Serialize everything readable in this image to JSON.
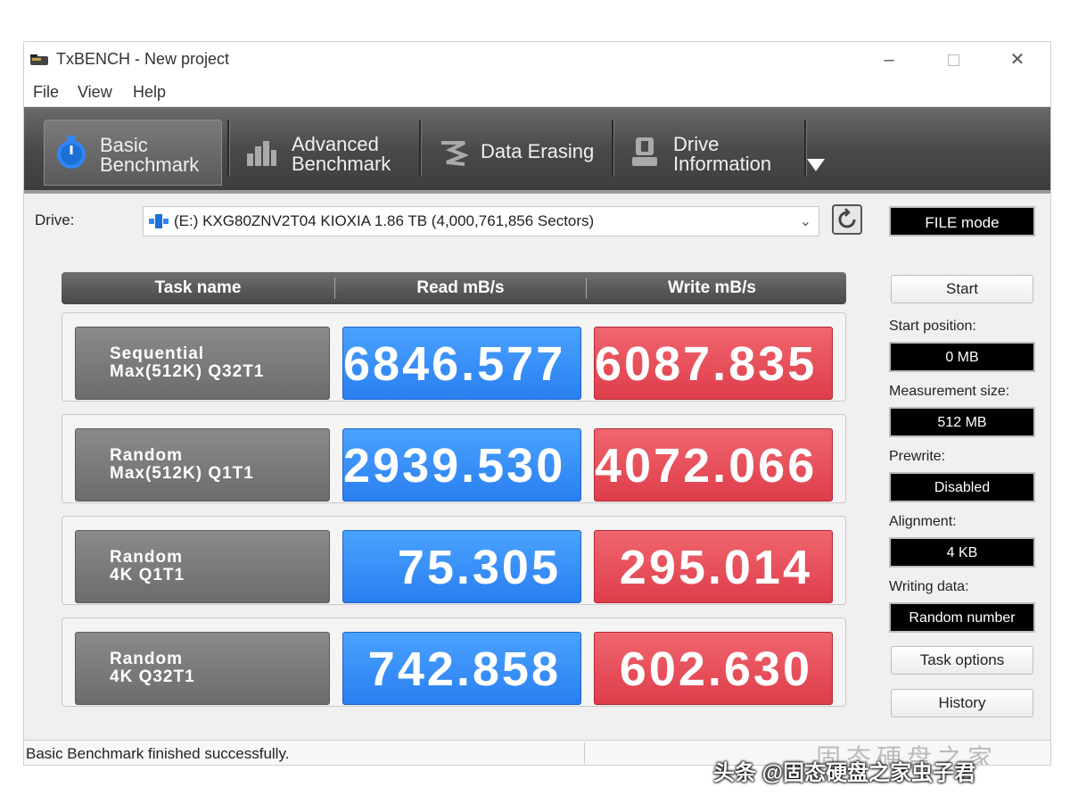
{
  "window": {
    "title": "TxBENCH - New project"
  },
  "menu": [
    "File",
    "View",
    "Help"
  ],
  "tabs": [
    {
      "line1": "Basic",
      "line2": "Benchmark",
      "icon": "stopwatch-icon",
      "active": true
    },
    {
      "line1": "Advanced",
      "line2": "Benchmark",
      "icon": "bar-chart-icon",
      "active": false
    },
    {
      "line1": "Data Erasing",
      "line2": "",
      "icon": "eraser-icon",
      "active": false
    },
    {
      "line1": "Drive",
      "line2": "Information",
      "icon": "drive-info-icon",
      "active": false
    }
  ],
  "drive": {
    "label": "Drive:",
    "value": "(E:) KXG80ZNV2T04 KIOXIA  1.86 TB (4,000,761,856 Sectors)"
  },
  "mode": "FILE mode",
  "table": {
    "headers": [
      "Task name",
      "Read mB/s",
      "Write mB/s"
    ],
    "rows": [
      {
        "name": "Sequential",
        "sub": "Max(512K) Q32T1",
        "read": "6846.577",
        "write": "6087.835"
      },
      {
        "name": "Random",
        "sub": "Max(512K) Q1T1",
        "read": "2939.530",
        "write": "4072.066"
      },
      {
        "name": "Random",
        "sub": "4K Q1T1",
        "read": "75.305",
        "write": "295.014"
      },
      {
        "name": "Random",
        "sub": "4K Q32T1",
        "read": "742.858",
        "write": "602.630"
      }
    ]
  },
  "panel": {
    "start": "Start",
    "start_position_label": "Start position:",
    "start_position": "0 MB",
    "measurement_size_label": "Measurement size:",
    "measurement_size": "512 MB",
    "prewrite_label": "Prewrite:",
    "prewrite": "Disabled",
    "alignment_label": "Alignment:",
    "alignment": "4 KB",
    "writing_data_label": "Writing data:",
    "writing_data": "Random number",
    "task_options": "Task options",
    "history": "History"
  },
  "status": {
    "text": "Basic Benchmark finished successfully.",
    "watermark": "固态硬盘之家"
  },
  "corner_watermark": "头条 @固态硬盘之家虫子君",
  "colors": {
    "read": "#2f86f5",
    "write": "#e34652",
    "toolbar": "#4a4a4a"
  }
}
